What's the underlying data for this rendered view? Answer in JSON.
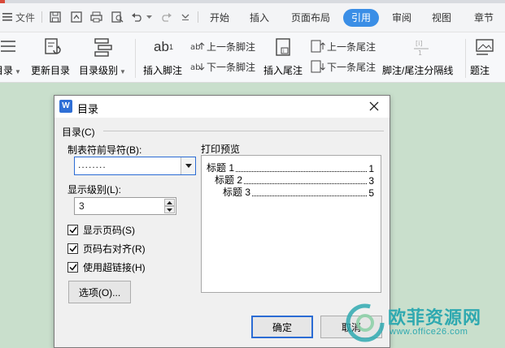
{
  "quick_access": {
    "file_label": "文件"
  },
  "menu": {
    "items": [
      "开始",
      "插入",
      "页面布局",
      "引用",
      "审阅",
      "视图",
      "章节"
    ],
    "active": "引用"
  },
  "ribbon": {
    "toc_label": "目录",
    "update_toc_label": "更新目录",
    "toc_level_label": "目录级别",
    "insert_footnote_label": "插入脚注",
    "footnote_icon_text": "ab",
    "prev_footnote_label": "上一条脚注",
    "next_footnote_label": "下一条脚注",
    "insert_endnote_label": "插入尾注",
    "prev_endnote_label": "上一条尾注",
    "next_endnote_label": "下一条尾注",
    "separator_label": "脚注/尾注分隔线",
    "caption_label": "题注"
  },
  "dialog": {
    "title": "目录",
    "section_label": "目录(C)",
    "tab_leader_label": "制表符前导符(B):",
    "tab_leader_value": "........",
    "level_label": "显示级别(L):",
    "level_value": "3",
    "show_page_numbers": {
      "label": "显示页码(S)",
      "checked": true
    },
    "right_align": {
      "label": "页码右对齐(R)",
      "checked": true
    },
    "hyperlinks": {
      "label": "使用超链接(H)",
      "checked": true
    },
    "options_button": "选项(O)...",
    "preview_label": "打印预览",
    "preview_lines": [
      {
        "text": "标题 1",
        "page": "1"
      },
      {
        "text": "标题 2",
        "page": "3"
      },
      {
        "text": "标题 3",
        "page": "5"
      }
    ],
    "ok_button": "确定",
    "cancel_button": "取消"
  },
  "watermark": {
    "brand": "欧菲资源网",
    "url": "www.office26.com"
  },
  "colors": {
    "accent": "#3a8ee6",
    "dialog_bg": "#f0f0f0",
    "document_bg": "#c9dfcc",
    "watermark": "#2fa9b0"
  }
}
